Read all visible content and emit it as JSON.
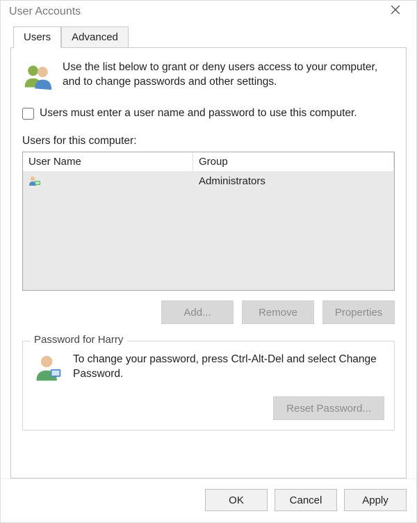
{
  "window": {
    "title": "User Accounts"
  },
  "tabs": {
    "users": "Users",
    "advanced": "Advanced"
  },
  "intro": "Use the list below to grant or deny users access to your computer, and to change passwords and other settings.",
  "mustEnterCheckbox": {
    "label": "Users must enter a user name and password to use this computer.",
    "checked": false
  },
  "listLabel": "Users for this computer:",
  "columns": {
    "user": "User Name",
    "group": "Group"
  },
  "rows": [
    {
      "userName": "",
      "group": "Administrators"
    }
  ],
  "buttons": {
    "add": "Add...",
    "remove": "Remove",
    "properties": "Properties",
    "resetPassword": "Reset Password...",
    "ok": "OK",
    "cancel": "Cancel",
    "apply": "Apply"
  },
  "passwordBox": {
    "legend": "Password for Harry",
    "text": "To change your password, press Ctrl-Alt-Del and select Change Password."
  }
}
